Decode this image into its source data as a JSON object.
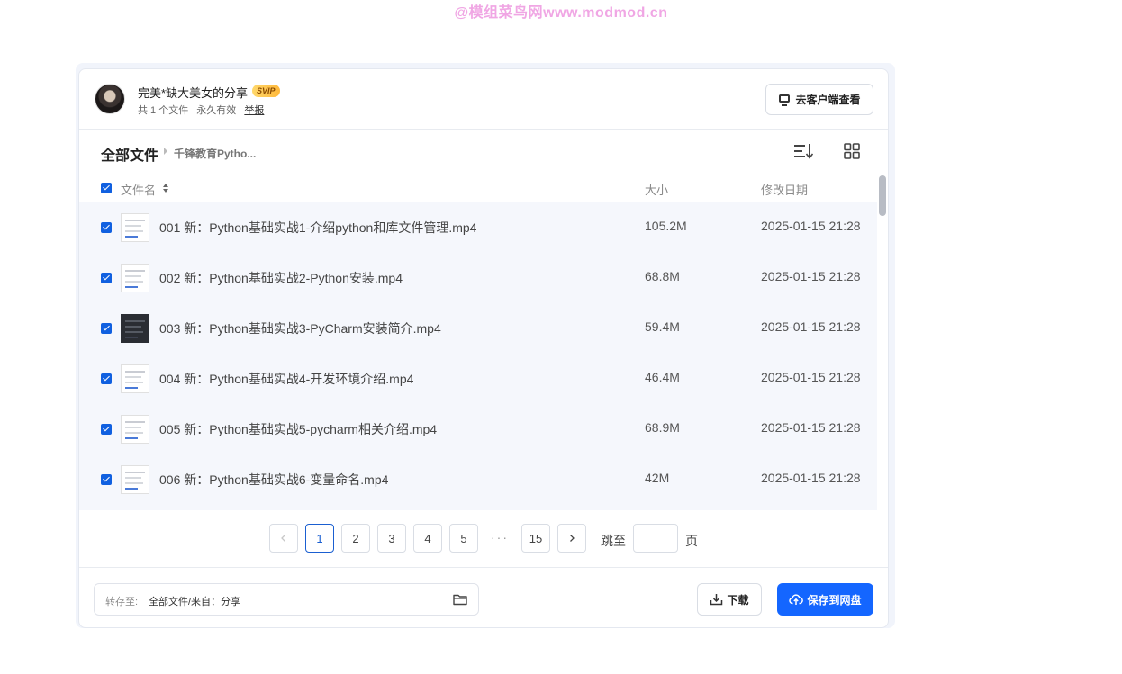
{
  "watermark": "@模组菜鸟网www.modmod.cn",
  "header": {
    "owner_name": "完美*缺大美女的分享",
    "vip_badge": "SVIP",
    "file_count": "共 1 个文件",
    "validity": "永久有效",
    "report_label": "举报",
    "client_button": "去客户端查看"
  },
  "breadcrumb": {
    "root": "全部文件",
    "current": "千锋教育Pytho..."
  },
  "table": {
    "columns": {
      "name": "文件名",
      "size": "大小",
      "date": "修改日期"
    },
    "rows": [
      {
        "name": "001 新：Python基础实战1-介绍python和库文件管理.mp4",
        "size": "105.2M",
        "date": "2025-01-15 21:28"
      },
      {
        "name": "002 新：Python基础实战2-Python安装.mp4",
        "size": "68.8M",
        "date": "2025-01-15 21:28"
      },
      {
        "name": "003 新：Python基础实战3-PyCharm安装简介.mp4",
        "size": "59.4M",
        "date": "2025-01-15 21:28"
      },
      {
        "name": "004 新：Python基础实战4-开发环境介绍.mp4",
        "size": "46.4M",
        "date": "2025-01-15 21:28"
      },
      {
        "name": "005 新：Python基础实战5-pycharm相关介绍.mp4",
        "size": "68.9M",
        "date": "2025-01-15 21:28"
      },
      {
        "name": "006 新：Python基础实战6-变量命名.mp4",
        "size": "42M",
        "date": "2025-01-15 21:28"
      }
    ]
  },
  "pagination": {
    "pages": [
      "1",
      "2",
      "3",
      "4",
      "5"
    ],
    "ellipsis": "···",
    "last_page": "15",
    "jump_label": "跳至",
    "jump_unit": "页"
  },
  "footer": {
    "save_to_label": "转存至:",
    "save_to_path": "全部文件/来自：分享",
    "download_button": "下载",
    "save_button": "保存到网盘"
  },
  "colors": {
    "accent": "#1466ff",
    "checkbox": "#1060e0",
    "row_background": "#f5f7fc"
  }
}
